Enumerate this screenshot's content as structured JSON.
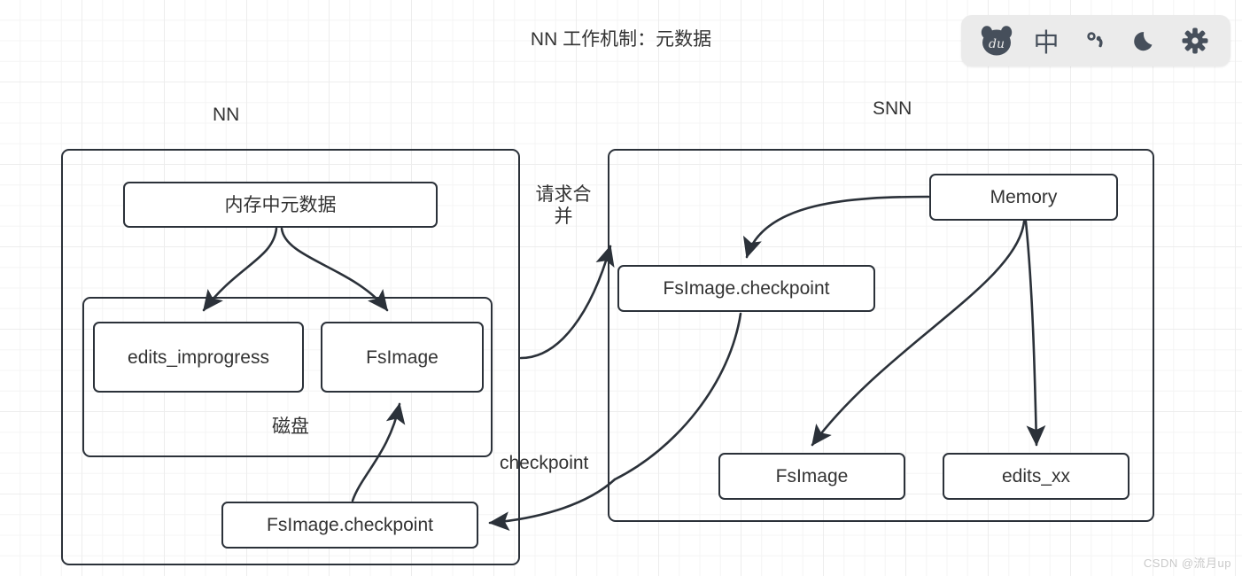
{
  "page": {
    "title": "NN 工作机制：元数据",
    "watermark": "CSDN @流月up"
  },
  "toolbar": {
    "items": [
      {
        "name": "baidu-bear-logo",
        "label": "du"
      },
      {
        "name": "chinese-input-icon",
        "label": "中"
      },
      {
        "name": "punctuation-icon",
        "label": "°,"
      },
      {
        "name": "moon-icon",
        "label": "☾"
      },
      {
        "name": "gear-icon",
        "label": "✿"
      }
    ]
  },
  "diagram": {
    "nn": {
      "section_label": "NN",
      "memory_metadata": "内存中元数据",
      "disk_label": "磁盘",
      "edits_improgress": "edits_improgress",
      "fsimage": "FsImage",
      "fsimage_checkpoint": "FsImage.checkpoint"
    },
    "snn": {
      "section_label": "SNN",
      "memory": "Memory",
      "fsimage_checkpoint": "FsImage.checkpoint",
      "fsimage": "FsImage",
      "edits_xx": "edits_xx"
    },
    "edges": {
      "request_merge": "请求合\n并",
      "request_merge_line1": "请求合",
      "request_merge_line2": "并",
      "checkpoint": "checkpoint"
    }
  }
}
